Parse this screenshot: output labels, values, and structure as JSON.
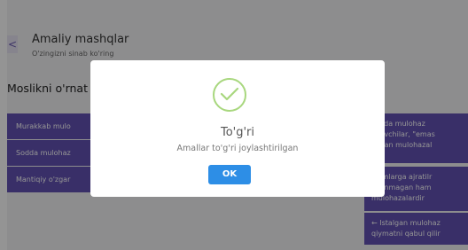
{
  "header": {
    "back_icon": "<",
    "title": "Amaliy mashqlar",
    "subtitle": "O'zingizni sinab ko'ring"
  },
  "task": {
    "title": "Moslikni o'rnat"
  },
  "left_items": [
    {
      "label": "Murakkab mulo"
    },
    {
      "label": "Sodda mulohaz"
    },
    {
      "label": "Mantiqiy o'zgar"
    }
  ],
  "right_items": [
    {
      "lines": [
        "sodda mulohaz",
        "g'lovchilar, \"emas",
        "lingan mulohazal"
      ]
    },
    {
      "lines": [
        "qismlarga ajratilr",
        "g'lanmagan ham",
        "mulohazalardir"
      ]
    },
    {
      "lines": [
        "← Istalgan mulohaz",
        "qiymatni qabul qilir"
      ]
    }
  ],
  "modal": {
    "icon": "check-icon",
    "title": "To'g'ri",
    "message": "Amallar to'g'ri joylashtirilgan",
    "ok_label": "OK"
  },
  "colors": {
    "accent": "#6352b3",
    "button": "#2d8ee6",
    "success": "#a8d77e"
  }
}
